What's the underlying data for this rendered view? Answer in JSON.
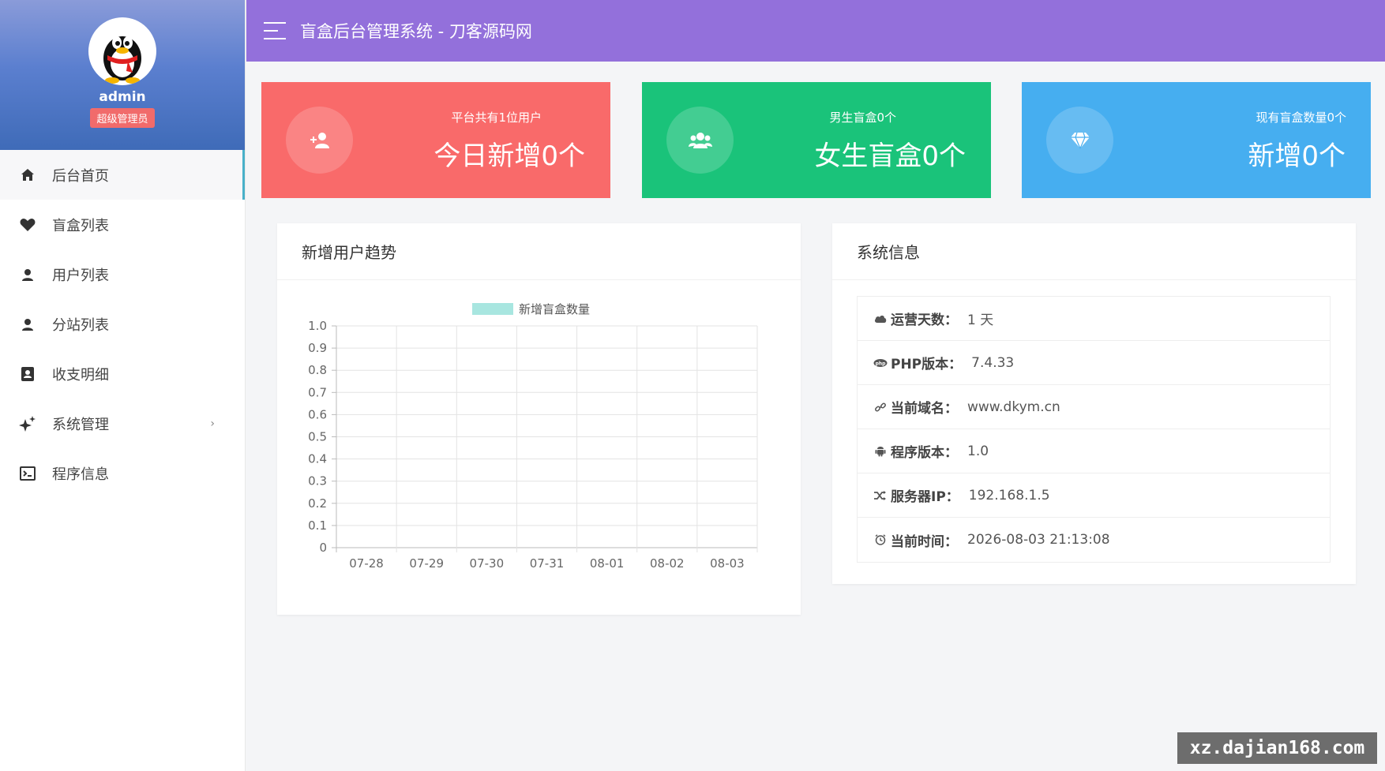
{
  "header": {
    "title": "盲盒后台管理系统 - 刀客源码网"
  },
  "profile": {
    "username": "admin",
    "role": "超级管理员"
  },
  "sidebar": {
    "items": [
      {
        "label": "后台首页",
        "icon": "home-icon"
      },
      {
        "label": "盲盒列表",
        "icon": "heart-icon"
      },
      {
        "label": "用户列表",
        "icon": "user-icon"
      },
      {
        "label": "分站列表",
        "icon": "user-icon"
      },
      {
        "label": "收支明细",
        "icon": "contacts-icon"
      },
      {
        "label": "系统管理",
        "icon": "sparkle-icon"
      },
      {
        "label": "程序信息",
        "icon": "terminal-icon"
      }
    ],
    "active": "后台首页"
  },
  "cards": [
    {
      "subtitle": "平台共有1位用户",
      "main": "今日新增0个",
      "color": "#f96a6a",
      "icon": "add-user-icon"
    },
    {
      "subtitle": "男生盲盒0个",
      "main": "女生盲盒0个",
      "color": "#1ac37a",
      "icon": "users-icon"
    },
    {
      "subtitle": "现有盲盒数量0个",
      "main": "新增0个",
      "color": "#46aef0",
      "icon": "diamond-icon"
    }
  ],
  "chart_panel": {
    "title": "新增用户趋势"
  },
  "chart_data": {
    "type": "bar",
    "categories": [
      "07-28",
      "07-29",
      "07-30",
      "07-31",
      "08-01",
      "08-02",
      "08-03"
    ],
    "series": [
      {
        "name": "新增盲盒数量",
        "values": [
          0,
          0,
          0,
          0,
          0,
          0,
          0
        ],
        "color": "#a8e6e0"
      }
    ],
    "yticks": [
      "1.0",
      "0.9",
      "0.8",
      "0.7",
      "0.6",
      "0.5",
      "0.4",
      "0.3",
      "0.2",
      "0.1",
      "0"
    ],
    "ylim": [
      0,
      1
    ],
    "grid": true,
    "legend": "top-center"
  },
  "info_panel": {
    "title": "系统信息",
    "rows": [
      {
        "label": "运营天数",
        "value": "1 天",
        "icon": "cloud-icon"
      },
      {
        "label": "PHP版本",
        "value": "7.4.33",
        "icon": "php-icon"
      },
      {
        "label": "当前域名",
        "value": "www.dkym.cn",
        "icon": "link-icon"
      },
      {
        "label": "程序版本",
        "value": "1.0",
        "icon": "android-icon"
      },
      {
        "label": "服务器IP",
        "value": "192.168.1.5",
        "icon": "shuffle-icon"
      },
      {
        "label": "当前时间",
        "value": "2026-08-03 21:13:08",
        "icon": "clock-icon"
      }
    ]
  },
  "watermark": "xz.dajian168.com"
}
